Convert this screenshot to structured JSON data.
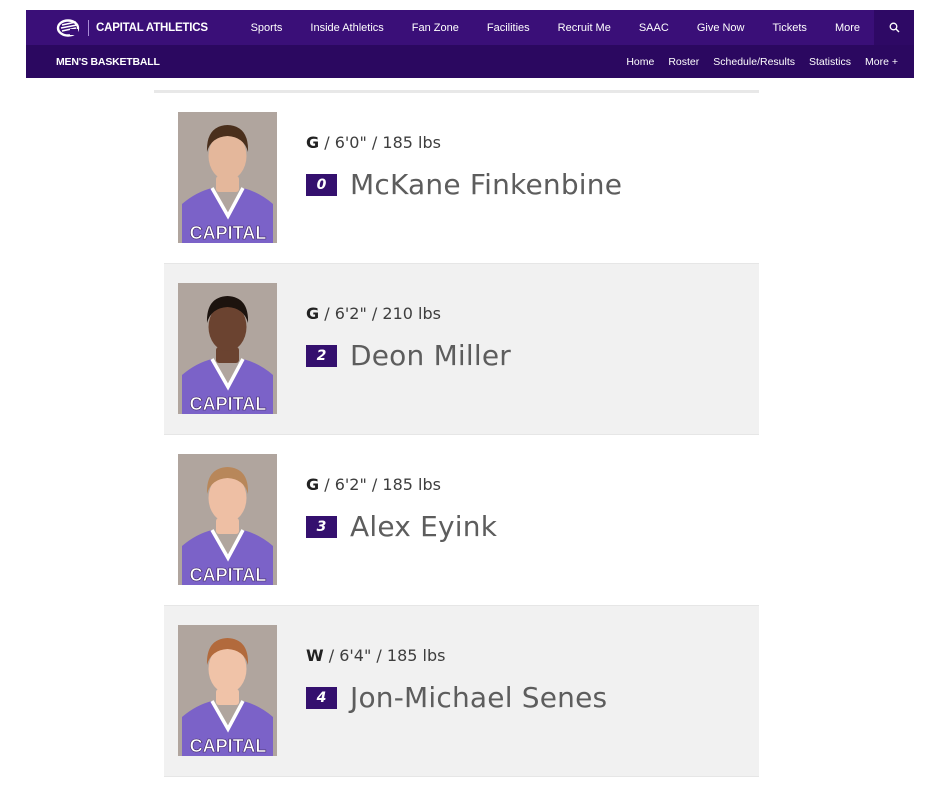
{
  "header": {
    "logo_icon": "wing-c-logo",
    "brand": "CAPITAL ATHLETICS",
    "nav": [
      "Sports",
      "Inside Athletics",
      "Fan Zone",
      "Facilities",
      "Recruit Me",
      "SAAC",
      "Give Now",
      "Tickets",
      "More"
    ],
    "search_icon": "search-icon"
  },
  "subheader": {
    "title": "MEN'S BASKETBALL",
    "links": [
      "Home",
      "Roster",
      "Schedule/Results",
      "Statistics",
      "More +"
    ]
  },
  "players": [
    {
      "position": "G",
      "details": " / 6'0\" / 185 lbs",
      "number": "0",
      "name": "McKane Finkenbine",
      "hair": "#4a2f1c",
      "skin": "#e4b79b"
    },
    {
      "position": "G",
      "details": " / 6'2\" / 210 lbs",
      "number": "2",
      "name": "Deon Miller",
      "hair": "#1c130e",
      "skin": "#6b4330"
    },
    {
      "position": "G",
      "details": " / 6'2\" / 185 lbs",
      "number": "3",
      "name": "Alex Eyink",
      "hair": "#b8875a",
      "skin": "#eebfa4"
    },
    {
      "position": "W",
      "details": " / 6'4\" / 185 lbs",
      "number": "4",
      "name": "Jon-Michael Senes",
      "hair": "#b26a3c",
      "skin": "#f0c3a8"
    }
  ],
  "jersey_text": "CAPITAL",
  "colors": {
    "primary": "#3a0f78",
    "secondary": "#2b0860",
    "badge": "#34106e",
    "jersey": "#7b62c8"
  }
}
